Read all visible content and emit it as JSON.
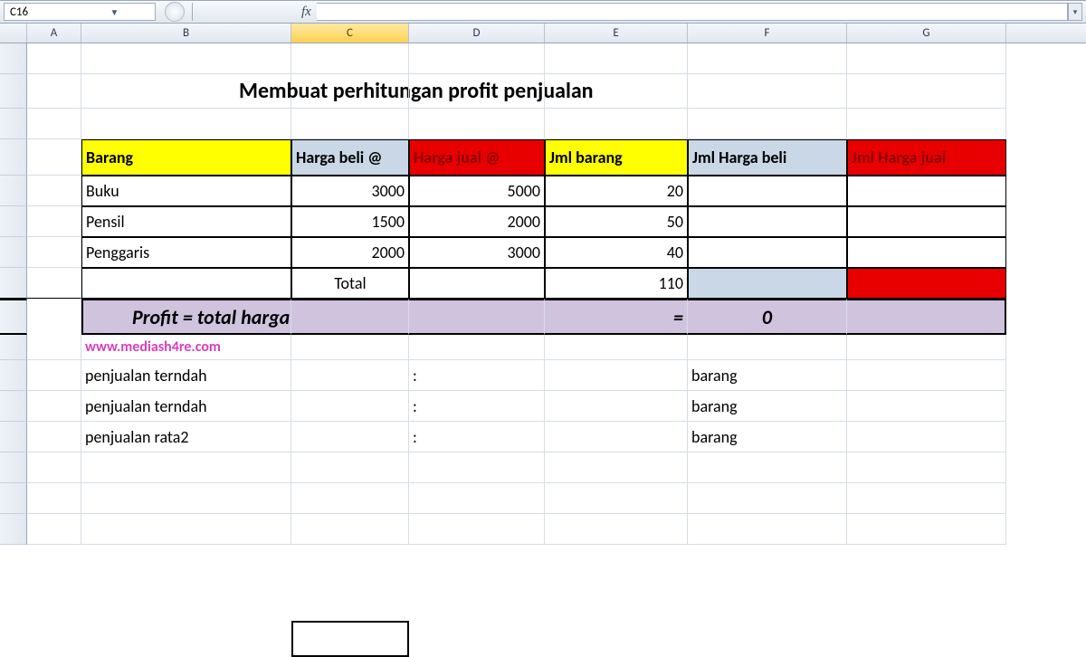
{
  "namebox": {
    "cell_ref": "C16"
  },
  "fx": {
    "label": "fx"
  },
  "columns": [
    "A",
    "B",
    "C",
    "D",
    "E",
    "F",
    "G"
  ],
  "active_column": "C",
  "title": "Membuat perhitungan profit penjualan",
  "headers": {
    "barang": "Barang",
    "harga_beli": "Harga beli @",
    "harga_jual": "Harga jual @",
    "jml_barang": "Jml barang",
    "jml_harga_beli": "Jml Harga beli",
    "jml_harga_jual": "Jml Harga jual"
  },
  "rows": [
    {
      "barang": "Buku",
      "beli": "3000",
      "jual": "5000",
      "jml": "20"
    },
    {
      "barang": "Pensil",
      "beli": "1500",
      "jual": "2000",
      "jml": "50"
    },
    {
      "barang": "Penggaris",
      "beli": "2000",
      "jual": "3000",
      "jml": "40"
    }
  ],
  "total": {
    "label": "Total",
    "jml": "110"
  },
  "profit": {
    "formula": "Profit = total harga jual - total harga beli",
    "eq": "=",
    "value": "0"
  },
  "website": "www.mediash4re.com",
  "summary": {
    "r1_label": "penjualan terndah",
    "r1_colon": ":",
    "r1_unit": "barang",
    "r2_label": "penjualan terndah",
    "r2_colon": ":",
    "r2_unit": "barang",
    "r3_label": "penjualan rata2",
    "r3_colon": ":",
    "r3_unit": "barang"
  }
}
